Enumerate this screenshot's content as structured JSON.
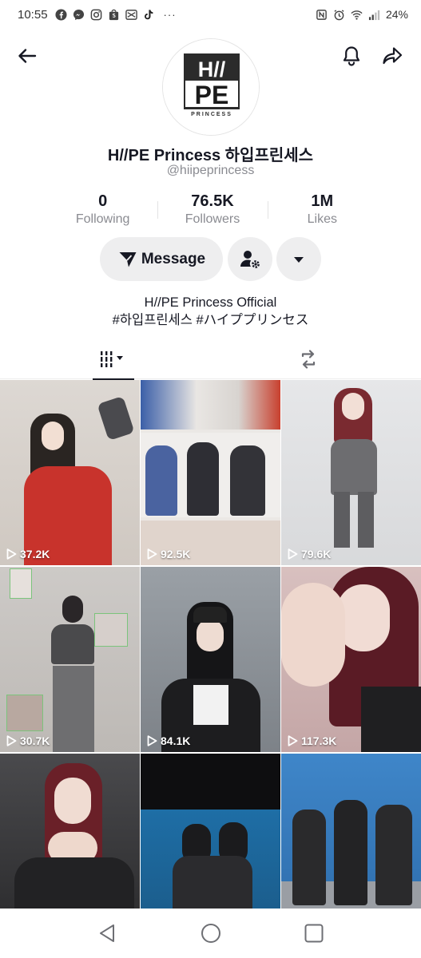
{
  "status_bar": {
    "time": "10:55",
    "dots": "···",
    "battery": "24%",
    "icons": [
      "facebook-icon",
      "messenger-icon",
      "instagram-icon",
      "shopee-icon",
      "capcut-icon",
      "tiktok-icon",
      "nfc-icon",
      "alarm-icon",
      "wifi-icon",
      "signal-icon"
    ]
  },
  "profile": {
    "avatar_text_top": "H//",
    "avatar_text_mid": "PE",
    "avatar_text_sub": "PRINCESS",
    "display_name": "H//PE Princess 하입프린세스",
    "handle": "@hiipeprincess",
    "stats": [
      {
        "value": "0",
        "label": "Following"
      },
      {
        "value": "76.5K",
        "label": "Followers"
      },
      {
        "value": "1M",
        "label": "Likes"
      }
    ],
    "message_label": "Message",
    "bio_line1": "H//PE Princess Official",
    "bio_line2": "#하입프린세스 #ハイププリンセス"
  },
  "videos": [
    {
      "views": "37.2K",
      "bg": "#d9d4cf",
      "accent": "#c8332c"
    },
    {
      "views": "92.5K",
      "bg": "#e9e6e3",
      "accent": "#3b5fa8"
    },
    {
      "views": "79.6K",
      "bg": "#dfe0e2",
      "accent": "#6b6b6d"
    },
    {
      "views": "30.7K",
      "bg": "#c9c6c3",
      "accent": "#4a4a4c"
    },
    {
      "views": "84.1K",
      "bg": "#8a8e94",
      "accent": "#1d1d1f"
    },
    {
      "views": "117.3K",
      "bg": "#c8a8a8",
      "accent": "#5a1b25"
    },
    {
      "views": "",
      "bg": "#3a3a3c",
      "accent": "#6a2028"
    },
    {
      "views": "",
      "bg": "#1f6fa6",
      "accent": "#1b1b1d"
    },
    {
      "views": "",
      "bg": "#3f86c9",
      "accent": "#2a2a2c"
    }
  ],
  "colors": {
    "text_primary": "#161823",
    "text_secondary": "#8a8b91",
    "button_bg": "#eeeeef"
  }
}
